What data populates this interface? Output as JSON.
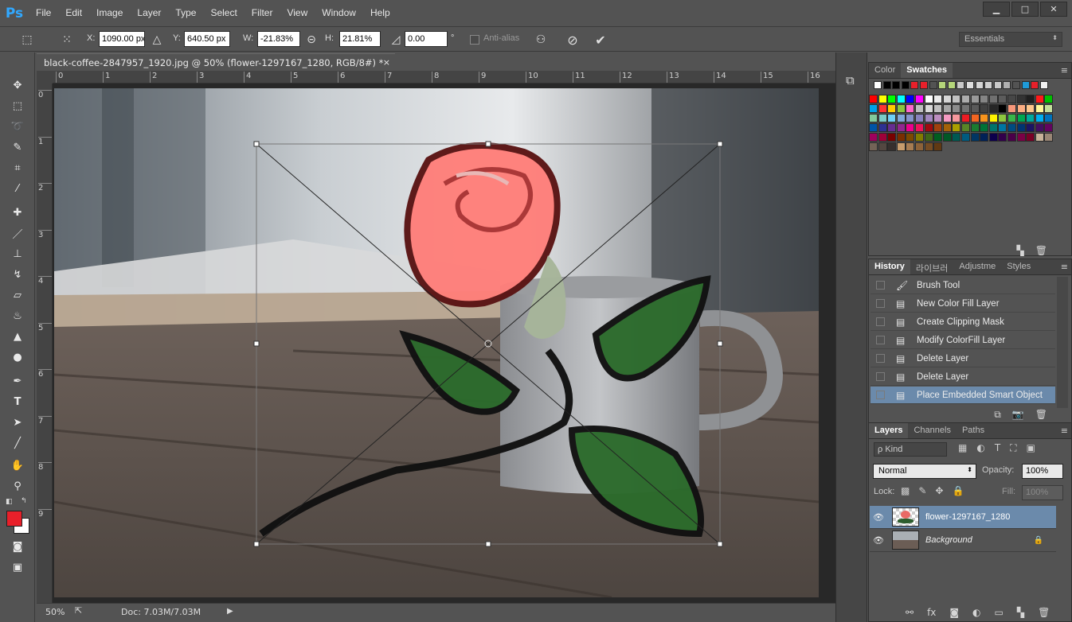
{
  "app": {
    "logo": "Ps",
    "menus": [
      "File",
      "Edit",
      "Image",
      "Layer",
      "Type",
      "Select",
      "Filter",
      "View",
      "Window",
      "Help"
    ],
    "window_controls": [
      "▁",
      "□",
      "✕"
    ]
  },
  "options": {
    "x_label": "X:",
    "x_value": "1090.00 px",
    "y_label": "Y:",
    "y_value": "640.50 px",
    "w_label": "W:",
    "w_value": "-21.83%",
    "h_label": "H:",
    "h_value": "21.81%",
    "angle_value": "0.00",
    "angle_unit": "°",
    "anti_alias": "Anti-alias",
    "workspace": "Essentials"
  },
  "document": {
    "tab_title": "black-coffee-2847957_1920.jpg @ 50% (flower-1297167_1280, RGB/8#) *",
    "close": "×",
    "ruler_top": [
      "0",
      "1",
      "2",
      "3",
      "4",
      "5",
      "6",
      "7",
      "8",
      "9",
      "10",
      "11",
      "12",
      "13",
      "14",
      "15",
      "16"
    ],
    "ruler_left": [
      "0",
      "1",
      "2",
      "3",
      "4",
      "5",
      "6",
      "7",
      "8",
      "9"
    ],
    "zoom": "50%",
    "doc_info": "Doc: 7.03M/7.03M"
  },
  "swatches_panel": {
    "tabs": [
      "Color",
      "Swatches"
    ],
    "active": "Swatches",
    "recent": [
      "#ffffff",
      "#000000",
      "#000000",
      "#000000",
      "#e8202a",
      "#e8202a",
      "#535353",
      "#b5d67a",
      "#b5d67a",
      "#c8c8c8",
      "#dddddd",
      "#d5d5d5",
      "#cfcfcf",
      "#c8c8c8",
      "#b0b0b0",
      "#535353",
      "#1f9bd8",
      "#e8202a",
      "#f2f2f2"
    ],
    "rows": [
      [
        "#ff0000",
        "#ffff00",
        "#00ff00",
        "#00ffff",
        "#0000ff",
        "#ff00ff",
        "#ffffff",
        "#ebebeb",
        "#d6d6d6",
        "#c2c2c2",
        "#adadad",
        "#999999",
        "#858585",
        "#707070",
        "#5c5c5c",
        "#474747",
        "#333333",
        "#1f1f1f",
        "#ff1a1a",
        "#00c000"
      ],
      [
        "#00a2e8",
        "#ff3333",
        "#ffcc00",
        "#8bc53f",
        "#ff66cc",
        "#bfbfbf",
        "#d9d9d9",
        "#c0c0c0",
        "#a6a6a6",
        "#8c8c8c",
        "#737373",
        "#595959",
        "#404040",
        "#262626",
        "#000000",
        "#f7977a",
        "#fbad82",
        "#fdc68c",
        "#fff799",
        "#c4df9b"
      ],
      [
        "#82ca9c",
        "#7accc8",
        "#6ecff6",
        "#7ea7d8",
        "#8493ca",
        "#8882be",
        "#a187be",
        "#bc8dbf",
        "#f49ac2",
        "#f6989d",
        "#ed1c24",
        "#f26522",
        "#f7941d",
        "#fff200",
        "#8dc63f",
        "#39b54a",
        "#00a651",
        "#00a99d",
        "#00aeef",
        "#0072bc"
      ],
      [
        "#0054a6",
        "#2e3192",
        "#662d91",
        "#92278f",
        "#ec008c",
        "#ed145b",
        "#9e0b0f",
        "#a0410d",
        "#a36209",
        "#aba000",
        "#598527",
        "#1a7b30",
        "#007236",
        "#00746b",
        "#0076a3",
        "#004b80",
        "#003471",
        "#1b1464",
        "#440e62",
        "#630460"
      ],
      [
        "#9e005d",
        "#9e0039",
        "#790000",
        "#7b2e00",
        "#7d4900",
        "#827b00",
        "#406618",
        "#005e20",
        "#005826",
        "#005952",
        "#005b7f",
        "#003663",
        "#002157",
        "#0d004c",
        "#32004b",
        "#4b0049",
        "#7b0046",
        "#7a0026",
        "#c7b299",
        "#998675"
      ],
      [
        "#736357",
        "#534741",
        "#362f2d",
        "#c69c6d",
        "#a67c52",
        "#8c6239",
        "#754c24",
        "#603913"
      ]
    ]
  },
  "history_panel": {
    "tabs": [
      "History",
      "라이브러",
      "Adjustme",
      "Styles"
    ],
    "active": "History",
    "items": [
      {
        "icon": "brush-icon",
        "glyph": "🖌",
        "label": "Brush Tool",
        "selected": false
      },
      {
        "icon": "history-state-icon",
        "glyph": "▤",
        "label": "New Color Fill Layer",
        "selected": false
      },
      {
        "icon": "history-state-icon",
        "glyph": "▤",
        "label": "Create Clipping Mask",
        "selected": false
      },
      {
        "icon": "history-state-icon",
        "glyph": "▤",
        "label": "Modify ColorFill Layer",
        "selected": false
      },
      {
        "icon": "history-state-icon",
        "glyph": "▤",
        "label": "Delete Layer",
        "selected": false
      },
      {
        "icon": "history-state-icon",
        "glyph": "▤",
        "label": "Delete Layer",
        "selected": false
      },
      {
        "icon": "history-state-icon",
        "glyph": "▤",
        "label": "Place Embedded Smart Object",
        "selected": true
      }
    ]
  },
  "layers_panel": {
    "tabs": [
      "Layers",
      "Channels",
      "Paths"
    ],
    "active": "Layers",
    "filter": "ρ Kind",
    "blend_mode": "Normal",
    "opacity_label": "Opacity:",
    "opacity_value": "100%",
    "lock_label": "Lock:",
    "fill_label": "Fill:",
    "fill_value": "100%",
    "layers": [
      {
        "name": "flower-1297167_1280",
        "selected": true,
        "italic": false
      },
      {
        "name": "Background",
        "selected": false,
        "italic": true
      }
    ]
  },
  "colors": {
    "foreground": "#e8202a",
    "background": "#ffffff",
    "accent_select": "#6b8aab"
  }
}
